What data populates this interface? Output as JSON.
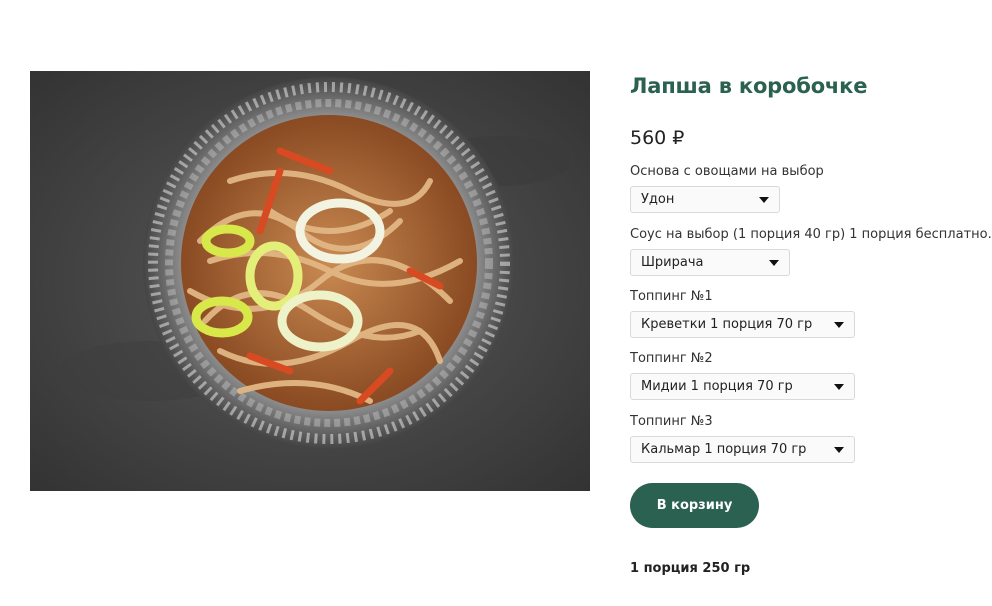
{
  "product": {
    "title": "Лапша в коробочке",
    "price": "560 ₽",
    "image_alt_icon": "noodle-bowl-photo"
  },
  "options": [
    {
      "label": "Основа с овощами на выбор",
      "value": "Удон"
    },
    {
      "label": "Соус на выбор (1 порция 40 гр) 1 порция бесплатно.",
      "value": "Шрирача"
    },
    {
      "label": "Топпинг №1",
      "value": "Креветки 1 порция 70 гр"
    },
    {
      "label": "Топпинг №2",
      "value": "Мидии 1 порция 70 гр"
    },
    {
      "label": "Топпинг №3",
      "value": "Кальмар 1 порция 70 гр"
    }
  ],
  "cart_button_label": "В корзину",
  "portion_text": "1 порция 250 гр",
  "colors": {
    "accent": "#2b6150",
    "background": "#ffffff"
  }
}
